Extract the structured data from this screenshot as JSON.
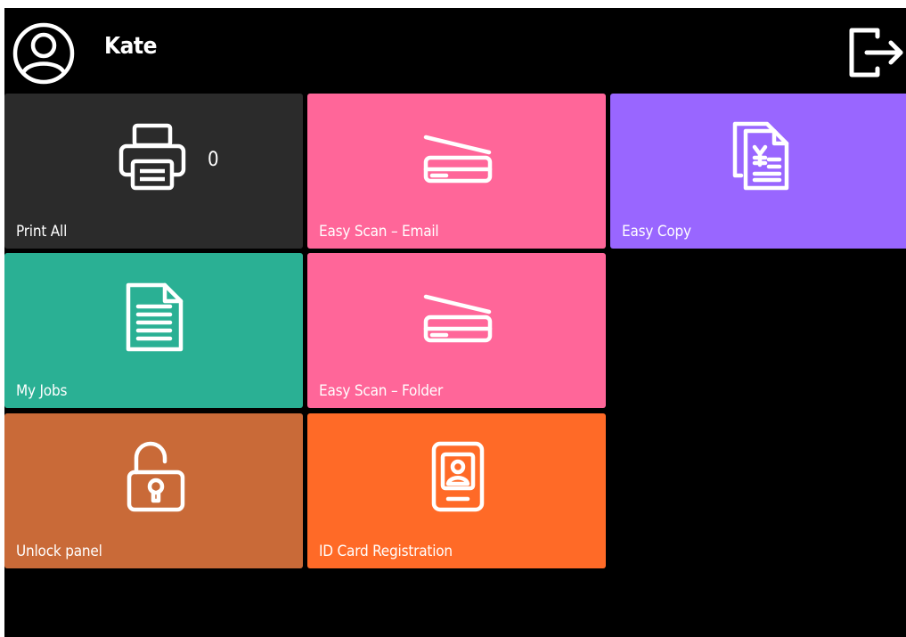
{
  "header": {
    "username": "Kate",
    "avatar_icon": "user-circle-icon",
    "logout_icon": "logout-icon"
  },
  "tiles": [
    {
      "label": "Print All",
      "count": "0",
      "icon": "printer-icon",
      "color": "#2b2b2b"
    },
    {
      "label": "Easy Scan – Email",
      "icon": "scanner-icon",
      "color": "#ff6699"
    },
    {
      "label": "Easy Copy",
      "icon": "copy-documents-icon",
      "color": "#9966ff"
    },
    {
      "label": "My Jobs",
      "icon": "document-icon",
      "color": "#2ab094"
    },
    {
      "label": "Easy Scan – Folder",
      "icon": "scanner-icon",
      "color": "#ff6699"
    },
    {
      "label": "Unlock panel",
      "icon": "unlock-icon",
      "color": "#c96a38"
    },
    {
      "label": "ID Card Registration",
      "icon": "id-card-icon",
      "color": "#ff6a27"
    }
  ]
}
